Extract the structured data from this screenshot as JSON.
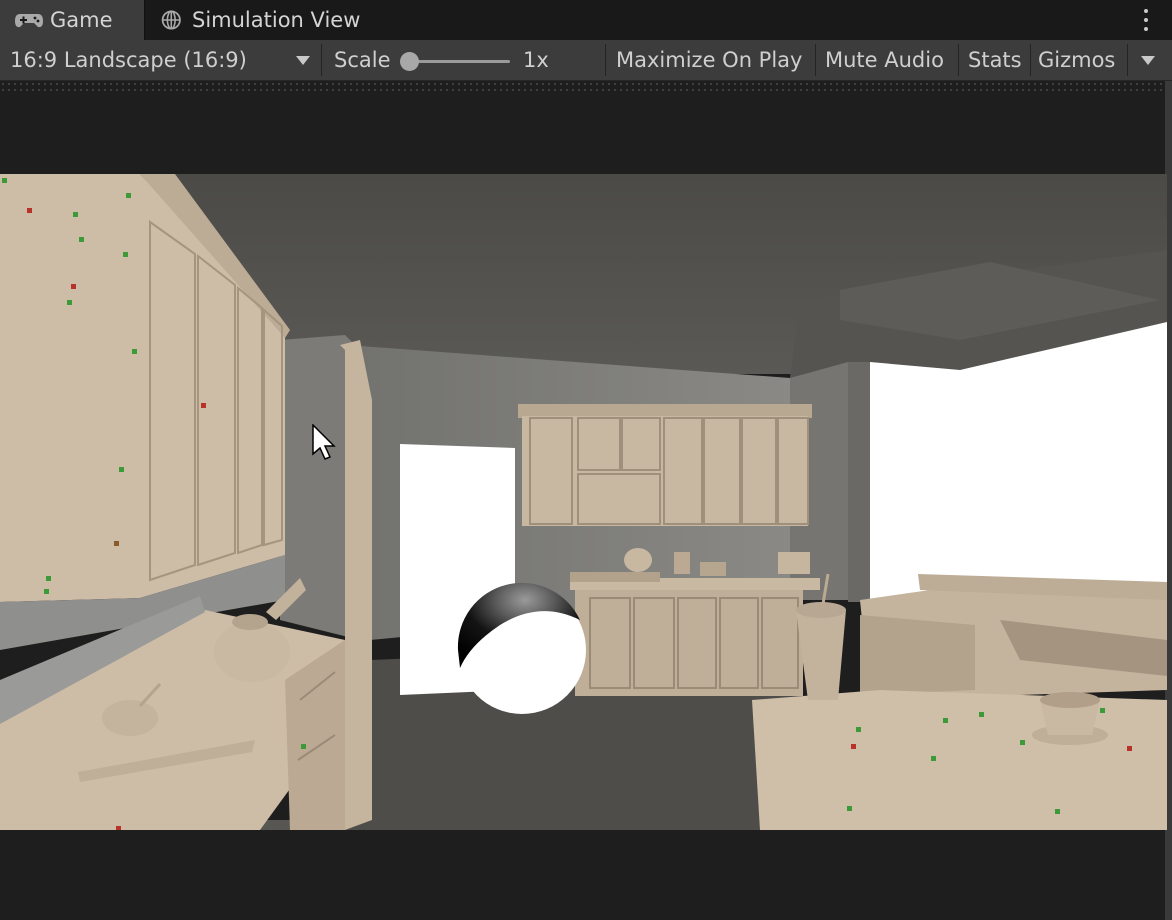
{
  "tabs": {
    "game": {
      "label": "Game",
      "icon": "gamepad-icon"
    },
    "simulation": {
      "label": "Simulation View",
      "icon": "globe-icon"
    },
    "menu_icon": "kebab-menu-icon"
  },
  "toolbar": {
    "aspect": {
      "selected": "16:9 Landscape (16:9)",
      "icon": "chevron-down-icon"
    },
    "scale": {
      "label": "Scale",
      "value_label": "1x",
      "value": 1
    },
    "maximize_on_play": "Maximize On Play",
    "mute_audio": "Mute Audio",
    "stats": "Stats",
    "gizmos": "Gizmos"
  },
  "colors": {
    "tab_bar": "#191919",
    "toolbar": "#3c3c3c",
    "background": "#1e1e1e",
    "cabinet": "#c9b8a3",
    "wall": "#5f5f5a"
  },
  "viewport": {
    "description_icon": "game-viewport"
  }
}
